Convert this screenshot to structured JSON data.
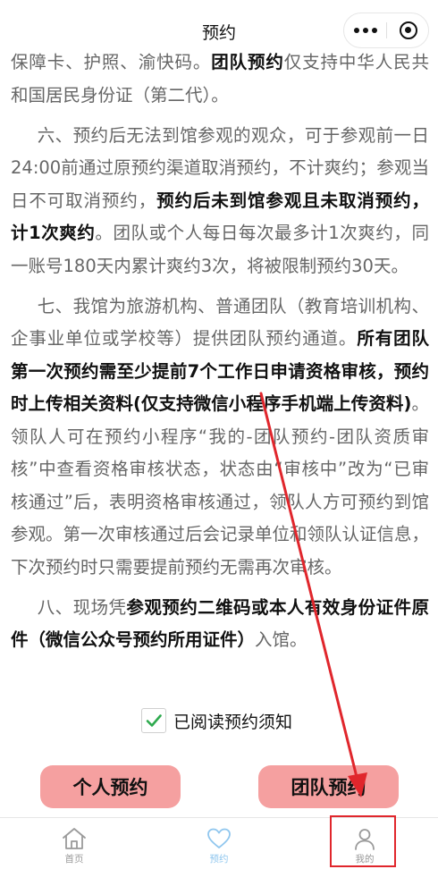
{
  "nav": {
    "title": "预约",
    "more_icon": "more-dots-icon",
    "close_icon": "mini-program-close-icon"
  },
  "rules": {
    "p1": {
      "t1": "保障卡、护照、渝快码。",
      "t2": "团队预约",
      "t3": "仅支持中华人民共和国居民身份证（第二代）。"
    },
    "p2": {
      "t1": "六、预约后无法到馆参观的观众，可于参观前一日24:00前通过原预约渠道取消预约，不计爽约；参观当日不可取消预约，",
      "t2": "预约后未到馆参观且未取消预约，计1次爽约",
      "t3": "。团队或个人每日每次最多计1次爽约，同一账号180天内累计爽约3次，将被限制预约30天。"
    },
    "p3": {
      "t1": "七、我馆为旅游机构、普通团队（教育培训机构、企事业单位或学校等）提供团队预约通道。",
      "t2": "所有团队第一次预约需至少提前7个工作日申请资格审核，预约时上传相关资料(仅支持微信小程序手机端上传资料)",
      "t3": "。领队人可在预约小程序“我的-团队预约-团队资质审核”中查看资格审核状态，状态由“审核中”改为“已审核通过”后，表明资格审核通过，领队人方可预约到馆参观。第一次审核通过后会记录单位和领队认证信息，下次预约时只需要提前预约无需再次审核。"
    },
    "p4": {
      "t1": "八、现场凭",
      "t2": "参观预约二维码或本人有效身份证件原件（微信公众号预约所用证件）",
      "t3": "入馆。"
    }
  },
  "agreement": {
    "label": "已阅读预约须知",
    "checked": true,
    "check_color": "#2eaa4e"
  },
  "buttons": {
    "personal": "个人预约",
    "team": "团队预约",
    "color": "#f5a0a0"
  },
  "tabbar": {
    "home": {
      "label": "首页",
      "icon": "home-icon"
    },
    "reserve": {
      "label": "预约",
      "icon": "heart-icon",
      "active": true
    },
    "mine": {
      "label": "我的",
      "icon": "person-icon"
    }
  },
  "annotation": {
    "color": "#e0262c",
    "target": "tab-mine"
  }
}
